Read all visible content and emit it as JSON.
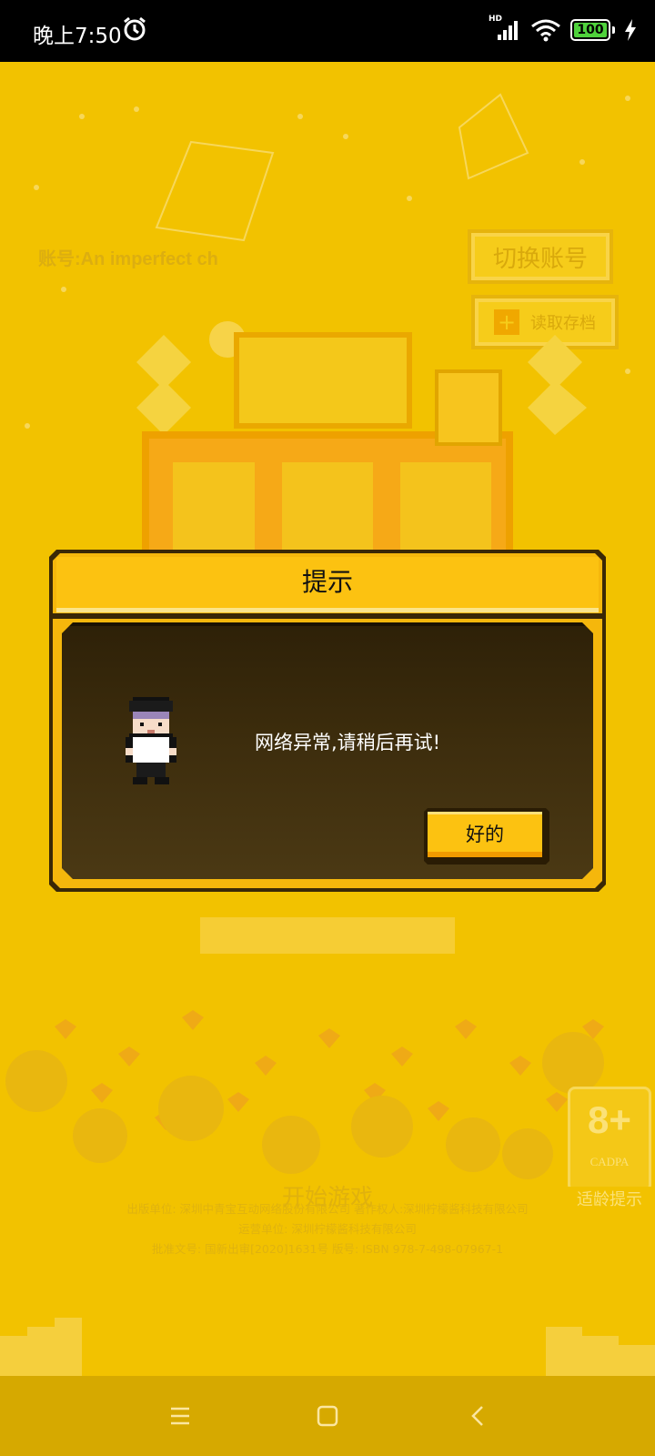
{
  "status_bar": {
    "time": "晚上7:50",
    "network_label": "HD",
    "battery_level": "100",
    "battery_color": "#4fd23c",
    "icons": [
      "alarm-icon",
      "signal-icon",
      "wifi-icon",
      "battery-icon",
      "charging-icon"
    ]
  },
  "background": {
    "account": "账号:An  imperfect  ch",
    "switch_account_label": "切换账号",
    "load_save_label": "读取存档",
    "start_game_label": "开始游戏",
    "rating": {
      "age": "8+",
      "org": "CADPA",
      "label": "适龄提示"
    },
    "legal": [
      "出版单位: 深圳中青宝互动网络股份有限公司  著作权人:深圳柠檬酱科技有限公司",
      "运营单位: 深圳柠檬酱科技有限公司",
      "批准文号: 国新出审[2020]1631号  版号: ISBN 978-7-498-07967-1"
    ],
    "brand_color": "#f2c200"
  },
  "dialog": {
    "title": "提示",
    "message": "网络异常,请稍后再试!",
    "ok_label": "好的"
  },
  "nav_bar": {
    "icons": [
      "menu-icon",
      "home-icon",
      "back-icon"
    ]
  }
}
